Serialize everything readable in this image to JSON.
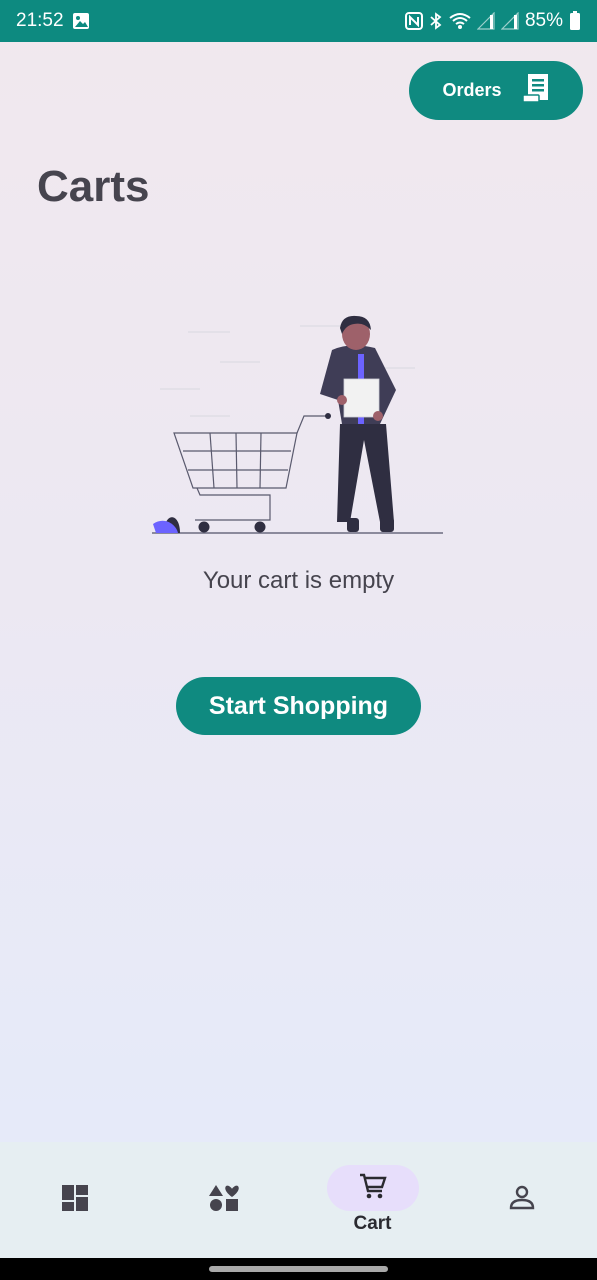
{
  "status_bar": {
    "time": "21:52",
    "battery": "85%",
    "icons": [
      "gallery-icon",
      "nfc-icon",
      "bluetooth-icon",
      "wifi-icon",
      "signal-icon",
      "signal-icon",
      "battery-icon"
    ]
  },
  "header": {
    "orders_label": "Orders",
    "orders_icon": "receipt-icon",
    "title": "Carts"
  },
  "empty_state": {
    "message": "Your cart is empty",
    "action_label": "Start Shopping",
    "illustration": "person-with-shopping-cart"
  },
  "bottom_nav": {
    "items": [
      {
        "icon": "dashboard-icon",
        "label": ""
      },
      {
        "icon": "categories-icon",
        "label": ""
      },
      {
        "icon": "cart-icon",
        "label": "Cart",
        "active": true
      },
      {
        "icon": "profile-icon",
        "label": ""
      }
    ]
  },
  "colors": {
    "primary": "#0f8a80",
    "status_bar": "#0d8a80",
    "active_pill": "#e7defb",
    "text": "#46444e"
  }
}
